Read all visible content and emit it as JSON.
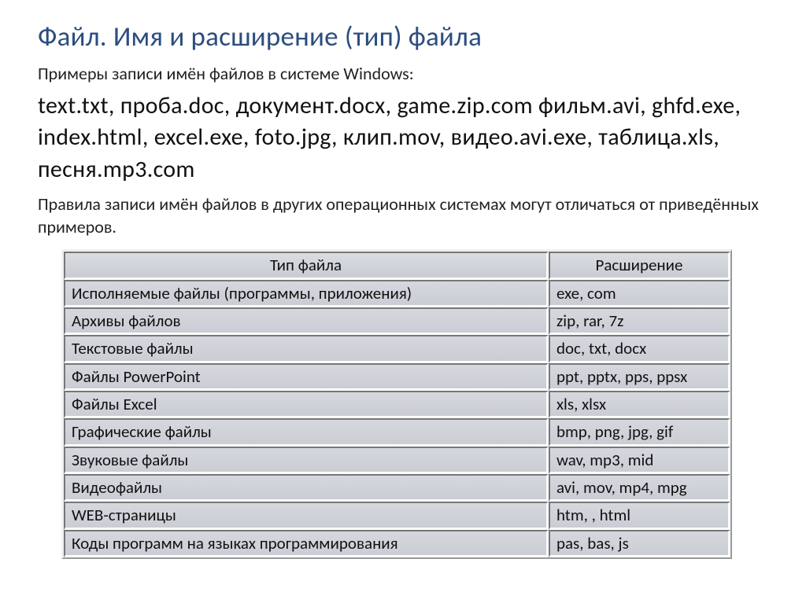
{
  "title": "Файл. Имя и расширение (тип) файла",
  "intro": "Примеры записи имён файлов в системе Windows:",
  "examples": "text.txt, проба.doc, документ.docx, game.zip.com фильм.avi, ghfd.exe, index.html, excel.exe, foto.jpg, клип.mov, видео.avi.exe, таблица.xls, песня.mp3.com",
  "note": "Правила записи имён файлов в других операционных системах могут отличаться от приведённых примеров.",
  "table": {
    "headers": {
      "type": "Тип файла",
      "ext": "Расширение"
    },
    "rows": [
      {
        "type": "Исполняемые файлы (программы, приложения)",
        "ext": "exe, com"
      },
      {
        "type": "Архивы файлов",
        "ext": "zip, rar, 7z"
      },
      {
        "type": "Текстовые файлы",
        "ext": "doc, txt, docx"
      },
      {
        "type": "Файлы PowerPoint",
        "ext": "ppt, pptx, pps, ppsx"
      },
      {
        "type": "Файлы Excel",
        "ext": "xls, xlsx"
      },
      {
        "type": "Графические файлы",
        "ext": "bmp, png, jpg, gif"
      },
      {
        "type": "Звуковые файлы",
        "ext": "wav, mp3, mid"
      },
      {
        "type": "Видеофайлы",
        "ext": "avi, mov, mp4, mpg"
      },
      {
        "type": "WEB-страницы",
        "ext": "htm, , html"
      },
      {
        "type": "Коды программ на языках программирования",
        "ext": "pas, bas, js"
      }
    ]
  }
}
